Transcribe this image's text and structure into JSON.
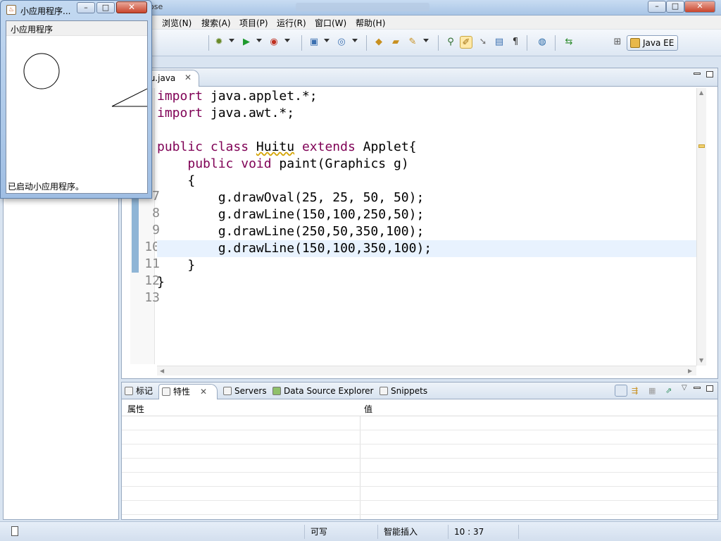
{
  "titlebar": {
    "title": "ose"
  },
  "menu": [
    "浏览(N)",
    "搜索(A)",
    "项目(P)",
    "运行(R)",
    "窗口(W)",
    "帮助(H)"
  ],
  "perspective": {
    "label": "Java EE"
  },
  "editor": {
    "tab_label": "tu.java",
    "line_numbers": [
      "7",
      "8",
      "9",
      "10",
      "11",
      "12",
      "13"
    ],
    "current_line": 10
  },
  "bottom": {
    "tabs": [
      "标记",
      "特性",
      "Servers",
      "Data Source Explorer",
      "Snippets"
    ],
    "columns": {
      "property": "属性",
      "value": "值"
    }
  },
  "status": {
    "writable": "可写",
    "insert_mode": "智能插入",
    "position": "10 : 37"
  },
  "applet": {
    "window_title": "小应用程序...",
    "menu_label": "小应用程序",
    "status_text": "已启动小应用程序。",
    "icon_glyph": "♨"
  },
  "window_controls": {
    "minimize": "–",
    "maximize": "□",
    "close": "✕"
  }
}
